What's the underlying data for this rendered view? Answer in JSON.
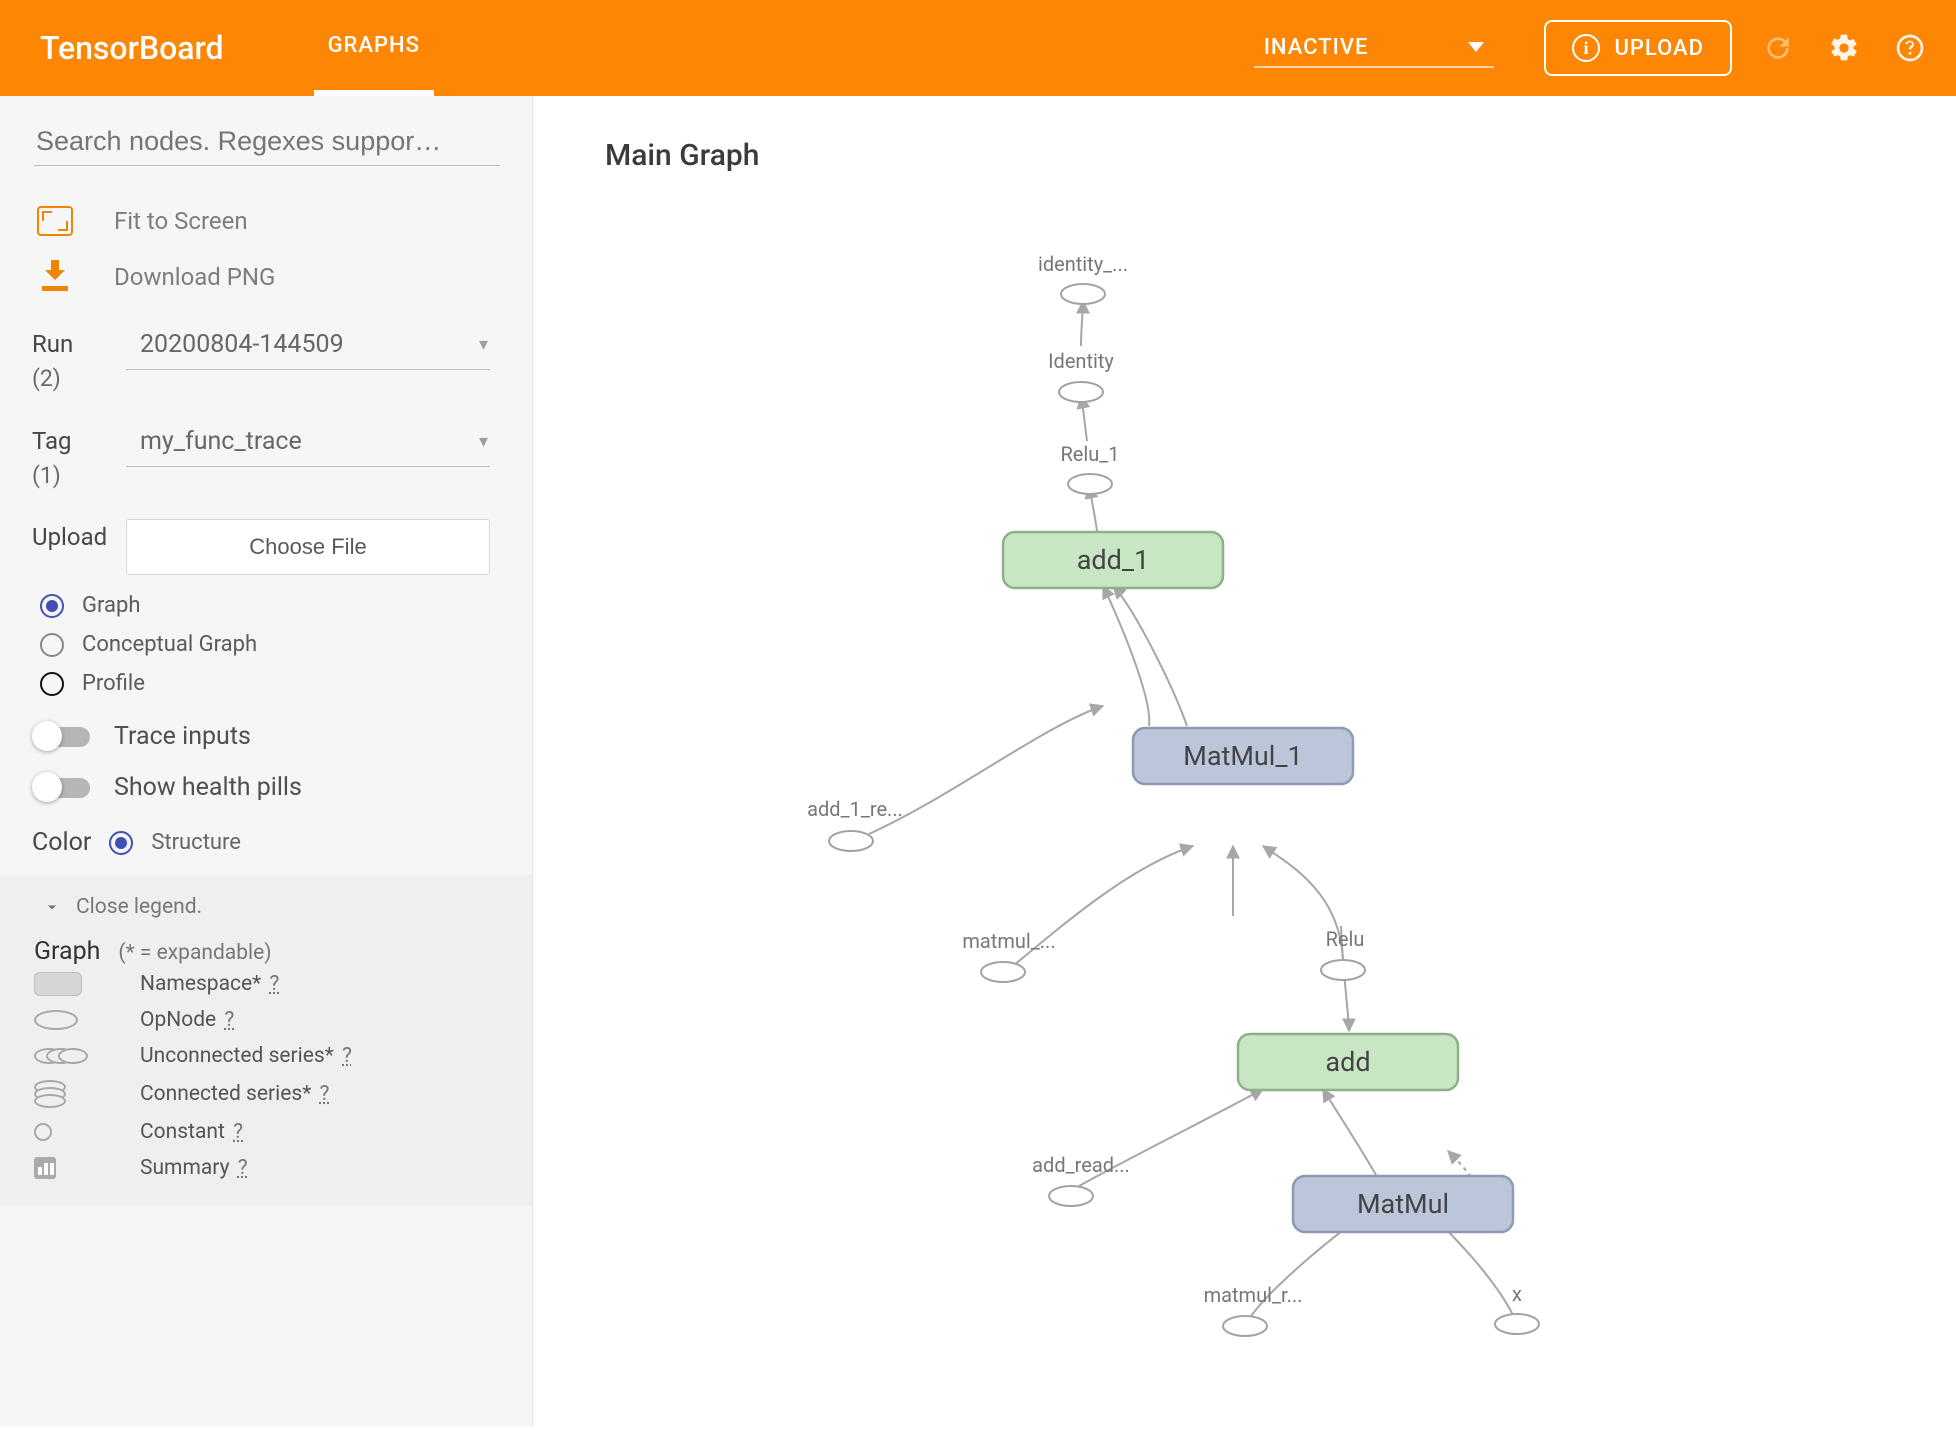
{
  "header": {
    "brand": "TensorBoard",
    "tab_graphs": "GRAPHS",
    "inactive_label": "INACTIVE",
    "upload_button": "UPLOAD"
  },
  "sidebar": {
    "search_placeholder": "Search nodes. Regexes suppor…",
    "fit_to_screen": "Fit to Screen",
    "download_png": "Download PNG",
    "run_label": "Run",
    "run_count": "(2)",
    "run_value": "20200804-144509",
    "tag_label": "Tag",
    "tag_count": "(1)",
    "tag_value": "my_func_trace",
    "upload_label": "Upload",
    "choose_file": "Choose File",
    "radio_graph": "Graph",
    "radio_conceptual": "Conceptual Graph",
    "radio_profile": "Profile",
    "toggle_trace": "Trace inputs",
    "toggle_health": "Show health pills",
    "color_label": "Color",
    "color_value": "Structure",
    "close_legend": "Close legend.",
    "legend_title": "Graph",
    "legend_hint": "(* = expandable)",
    "legend_namespace_label": "Namespace*",
    "legend_opnode_label": "OpNode",
    "legend_unconnected_label": "Unconnected series*",
    "legend_connected_label": "Connected series*",
    "legend_constant_label": "Constant",
    "legend_summary_label": "Summary",
    "legend_q": "?"
  },
  "main": {
    "title": "Main Graph",
    "nodes": {
      "identity_ret": "identity_...",
      "identity": "Identity",
      "relu1": "Relu_1",
      "add1": "add_1",
      "matmul1": "MatMul_1",
      "add1_re": "add_1_re...",
      "matmul_dots": "matmul_...",
      "relu": "Relu",
      "add": "add",
      "matmul": "MatMul",
      "add_read": "add_read...",
      "matmul_r": "matmul_r...",
      "x": "x"
    }
  }
}
